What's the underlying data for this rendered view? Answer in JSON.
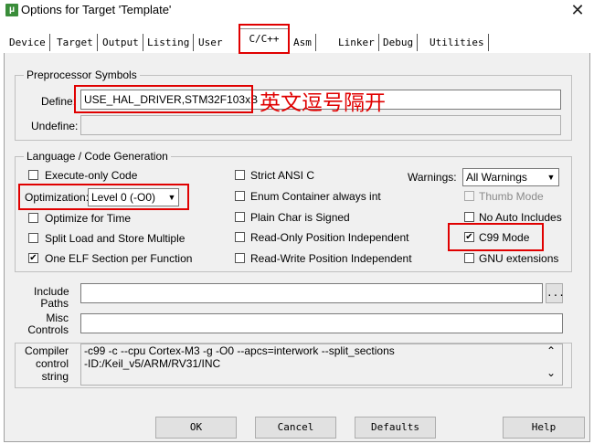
{
  "window": {
    "title": "Options for Target 'Template'",
    "close_glyph": "✕",
    "app_icon": "keil-icon",
    "app_icon_glyph": "μ"
  },
  "tabs": [
    {
      "label": "Device"
    },
    {
      "label": "Target"
    },
    {
      "label": "Output"
    },
    {
      "label": "Listing"
    },
    {
      "label": "User"
    },
    {
      "label": "C/C++",
      "active": true
    },
    {
      "label": "Asm"
    },
    {
      "label": "Linker"
    },
    {
      "label": "Debug"
    },
    {
      "label": "Utilities"
    }
  ],
  "preprocessor": {
    "group_title": "Preprocessor Symbols",
    "define_label": "Define:",
    "define_value": "USE_HAL_DRIVER,STM32F103xB",
    "undefine_label": "Undefine:",
    "undefine_value": ""
  },
  "annotation": {
    "text": "英文逗号隔开",
    "color": "#e00000"
  },
  "language": {
    "group_title": "Language / Code Generation",
    "execute_only": {
      "label": "Execute-only Code",
      "checked": false
    },
    "optimization_label": "Optimization:",
    "optimization_value": "Level 0 (-O0)",
    "optimize_time": {
      "label": "Optimize for Time",
      "checked": false
    },
    "split_load": {
      "label": "Split Load and Store Multiple",
      "checked": false
    },
    "one_elf": {
      "label": "One ELF Section per Function",
      "checked": true
    },
    "strict_ansi": {
      "label": "Strict ANSI C",
      "checked": false
    },
    "enum_container": {
      "label": "Enum Container always int",
      "checked": false
    },
    "plain_char": {
      "label": "Plain Char is Signed",
      "checked": false
    },
    "ro_pi": {
      "label": "Read-Only Position Independent",
      "checked": false
    },
    "rw_pi": {
      "label": "Read-Write Position Independent",
      "checked": false
    },
    "warnings_label": "Warnings:",
    "warnings_value": "All Warnings",
    "thumb_mode": {
      "label": "Thumb Mode",
      "checked": false,
      "disabled": true
    },
    "no_auto_includes": {
      "label": "No Auto Includes",
      "checked": false
    },
    "c99_mode": {
      "label": "C99 Mode",
      "checked": true
    },
    "gnu_extensions": {
      "label": "GNU extensions",
      "checked": false
    }
  },
  "paths": {
    "include_label_1": "Include",
    "include_label_2": "Paths",
    "include_value": "",
    "browse_label": "...",
    "misc_label_1": "Misc",
    "misc_label_2": "Controls",
    "misc_value": ""
  },
  "compiler": {
    "label_1": "Compiler",
    "label_2": "control",
    "label_3": "string",
    "line_1": "-c99 -c --cpu Cortex-M3 -g -O0 --apcs=interwork --split_sections",
    "line_2": "-ID:/Keil_v5/ARM/RV31/INC",
    "scroll_up": "⌃",
    "scroll_down": "⌄"
  },
  "buttons": {
    "ok": "OK",
    "cancel": "Cancel",
    "defaults": "Defaults",
    "help": "Help"
  },
  "glyphs": {
    "check": "✔",
    "dropdown": "▼"
  },
  "colors": {
    "highlight_box": "#e00000",
    "dialog_bg": "#f0f0f0"
  }
}
